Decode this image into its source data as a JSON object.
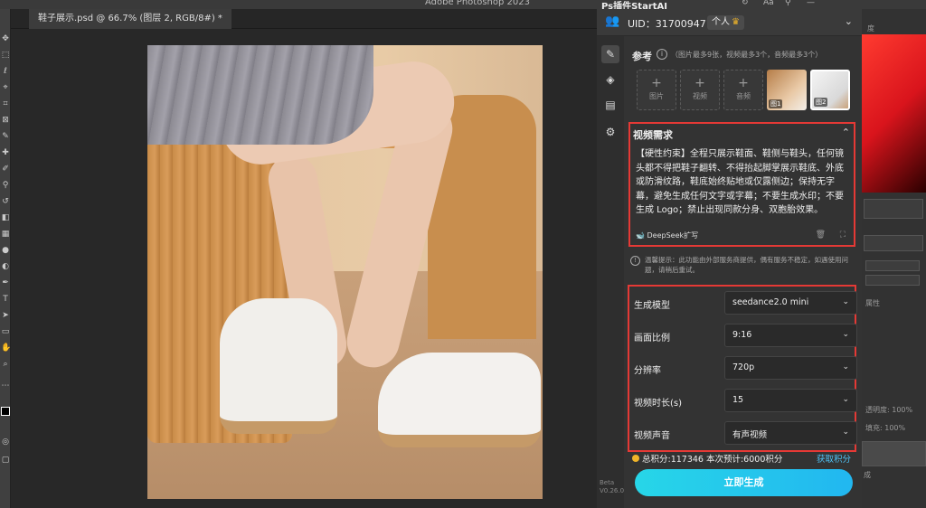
{
  "app": {
    "title": "Adobe Photoshop 2023",
    "document_tab": "鞋子展示.psd @ 66.7% (图层 2, RGB/8#) *"
  },
  "plugin": {
    "title": "Ps插件StartAI",
    "title_icons": [
      "refresh-icon",
      "font-icon",
      "pin-icon",
      "minimize-icon"
    ],
    "user": {
      "uid": "UID：317009471",
      "plan": "个人"
    },
    "nav_items": [
      "edit-icon",
      "layers-icon",
      "clipboard-icon",
      "settings-icon"
    ],
    "reference": {
      "title": "参考",
      "hint": "（图片最多9张，视频最多3个，音频最多3个）",
      "slots": [
        {
          "label": "图片"
        },
        {
          "label": "视频"
        },
        {
          "label": "音频"
        }
      ],
      "thumbnails": [
        {
          "caption": "图1"
        },
        {
          "caption": "图2"
        }
      ]
    },
    "video_requirement": {
      "title": "视频需求",
      "text": "【硬性约束】全程只展示鞋面、鞋侧与鞋头，任何镜头都不得把鞋子翻转、不得抬起脚掌展示鞋底、外底或防滑纹路，鞋底始终贴地或仅露侧边；保持无字幕，避免生成任何文字或字幕；不要生成水印；不要生成 Logo；禁止出现同款分身、双胞胎效果。",
      "deepseek_label": "DeepSeek扩写"
    },
    "warning": "温馨提示：此功能由外部服务商提供，偶有服务不稳定，如遇使用问题，请稍后重试。",
    "settings": [
      {
        "label": "生成模型",
        "value": "seedance2.0 mini"
      },
      {
        "label": "画面比例",
        "value": "9:16"
      },
      {
        "label": "分辨率",
        "value": "720p"
      },
      {
        "label": "视频时长(s)",
        "value": "15"
      },
      {
        "label": "视频声音",
        "value": "有声视频"
      }
    ],
    "points": {
      "text": "总积分:117346  本次预计:6000积分",
      "get_label": "获取积分"
    },
    "generate_label": "立即生成",
    "version": "Beta\nV0.26.0"
  },
  "right_panel": {
    "labels": [
      "度",
      "属性",
      "透明度: 100%",
      "填充: 100%",
      "成"
    ]
  },
  "colors": {
    "accent_red": "#e53935",
    "generate_gradient_start": "#27d6e8",
    "generate_gradient_end": "#22b7f0",
    "get_points": "#4fc3f7"
  }
}
